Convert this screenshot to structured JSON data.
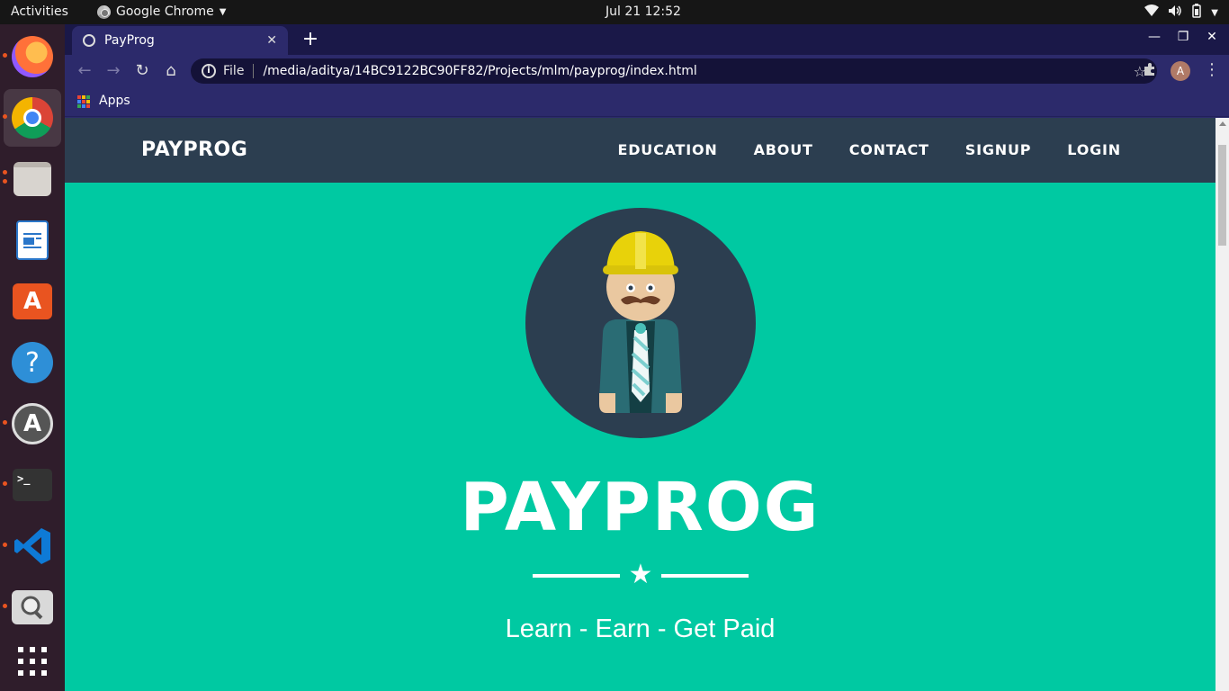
{
  "topbar": {
    "activities": "Activities",
    "app_menu": "Google Chrome",
    "clock": "Jul 21  12:52"
  },
  "dock": {
    "items": [
      {
        "name": "firefox",
        "color": "#ff7139"
      },
      {
        "name": "chrome",
        "color": "#4285f4",
        "active": true
      },
      {
        "name": "files",
        "color": "#d8d4cf"
      },
      {
        "name": "writer",
        "color": "#2a76c9"
      },
      {
        "name": "software",
        "color": "#e95420"
      },
      {
        "name": "help",
        "color": "#2e8fd7"
      },
      {
        "name": "updater",
        "color": "#555555"
      },
      {
        "name": "terminal",
        "color": "#333333"
      },
      {
        "name": "vscode",
        "color": "#0e7ad6"
      },
      {
        "name": "search",
        "color": "#bdbdbd"
      }
    ]
  },
  "browser": {
    "tab_title": "PayProg",
    "omnibox": {
      "scheme": "File",
      "url": "/media/aditya/14BC9122BC90FF82/Projects/mlm/payprog/index.html"
    },
    "avatar_letter": "A",
    "bookmarks_apps": "Apps"
  },
  "site": {
    "brand": "PAYPROG",
    "nav": [
      "EDUCATION",
      "ABOUT",
      "CONTACT",
      "SIGNUP",
      "LOGIN"
    ],
    "hero_title": "PAYPROG",
    "tagline": "Learn - Earn - Get Paid",
    "colors": {
      "nav_bg": "#2c3e50",
      "hero_bg": "#00c9a2",
      "text": "#ffffff"
    }
  }
}
